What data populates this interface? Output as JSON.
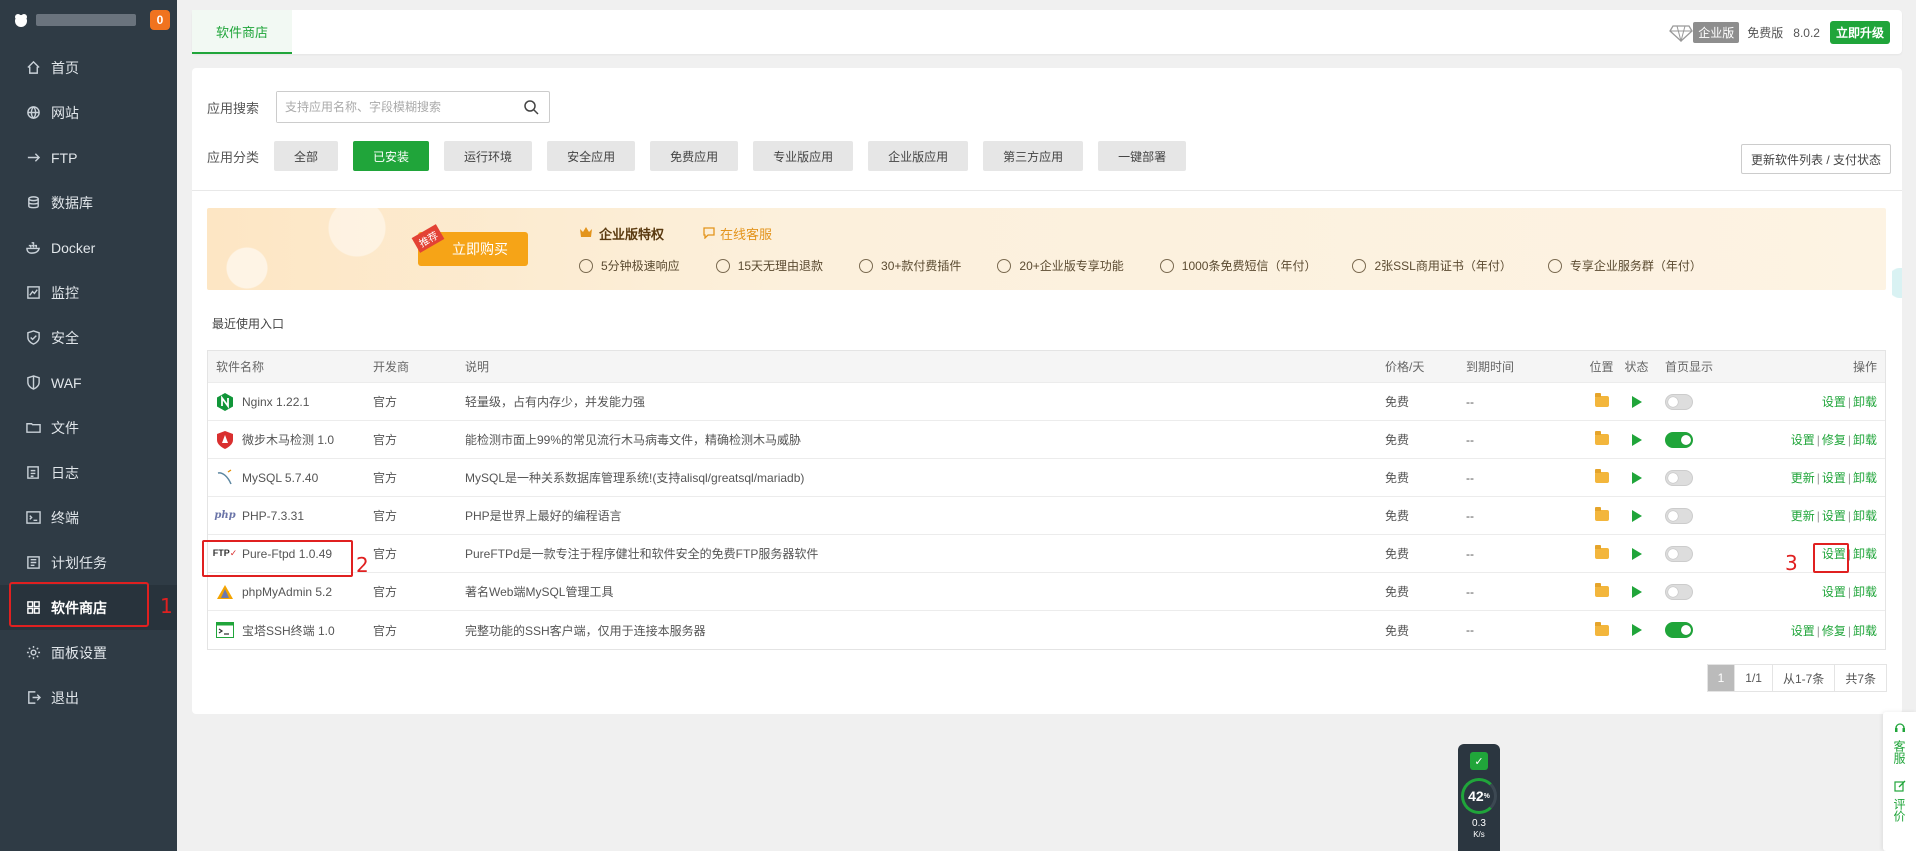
{
  "sidebar": {
    "badge": "0",
    "items": [
      {
        "label": "首页",
        "icon": "home-icon"
      },
      {
        "label": "网站",
        "icon": "globe-icon"
      },
      {
        "label": "FTP",
        "icon": "ftp-icon"
      },
      {
        "label": "数据库",
        "icon": "database-icon"
      },
      {
        "label": "Docker",
        "icon": "docker-icon"
      },
      {
        "label": "监控",
        "icon": "monitor-icon"
      },
      {
        "label": "安全",
        "icon": "shield-icon"
      },
      {
        "label": "WAF",
        "icon": "waf-shield-icon"
      },
      {
        "label": "文件",
        "icon": "folder-icon"
      },
      {
        "label": "日志",
        "icon": "log-icon"
      },
      {
        "label": "终端",
        "icon": "terminal-icon"
      },
      {
        "label": "计划任务",
        "icon": "clock-icon"
      },
      {
        "label": "软件商店",
        "icon": "grid-icon"
      },
      {
        "label": "面板设置",
        "icon": "gear-icon"
      },
      {
        "label": "退出",
        "icon": "logout-icon"
      }
    ],
    "active_index": 12
  },
  "annotations": {
    "one": "1",
    "two": "2",
    "three": "3"
  },
  "topbar": {
    "tab": "软件商店",
    "enterprise_tag": "企业版",
    "free_label": "免费版",
    "version": "8.0.2",
    "upgrade": "立即升级"
  },
  "search": {
    "label": "应用搜索",
    "placeholder": "支持应用名称、字段模糊搜索"
  },
  "categories": {
    "label": "应用分类",
    "items": [
      "全部",
      "已安装",
      "运行环境",
      "安全应用",
      "免费应用",
      "专业版应用",
      "企业版应用",
      "第三方应用",
      "一键部署"
    ],
    "active_index": 1
  },
  "refresh_button": "更新软件列表 / 支付状态",
  "banner": {
    "recommend_tag": "推荐",
    "buy": "立即购买",
    "privilege": "企业版特权",
    "online_service": "在线客服",
    "features": [
      "5分钟极速响应",
      "15天无理由退款",
      "30+款付费插件",
      "20+企业版专享功能",
      "1000条免费短信（年付）",
      "2张SSL商用证书（年付）",
      "专享企业服务群（年付）"
    ]
  },
  "recent_label": "最近使用入口",
  "table": {
    "headers": [
      "软件名称",
      "开发商",
      "说明",
      "价格/天",
      "到期时间",
      "位置",
      "状态",
      "首页显示",
      "操作"
    ],
    "rows": [
      {
        "name": "Nginx 1.22.1",
        "dev": "官方",
        "desc": "轻量级，占有内存少，并发能力强",
        "price": "免费",
        "expire": "--",
        "home_on": false,
        "actions": [
          "设置",
          "卸载"
        ],
        "icon": "nginx-icon"
      },
      {
        "name": "微步木马检测 1.0",
        "dev": "官方",
        "desc": "能检测市面上99%的常见流行木马病毒文件，精确检测木马威胁",
        "price": "免费",
        "expire": "--",
        "home_on": true,
        "actions": [
          "设置",
          "修复",
          "卸载"
        ],
        "icon": "shield-red-icon"
      },
      {
        "name": "MySQL 5.7.40",
        "dev": "官方",
        "desc": "MySQL是一种关系数据库管理系统!(支持alisql/greatsql/mariadb)",
        "price": "免费",
        "expire": "--",
        "home_on": false,
        "actions": [
          "更新",
          "设置",
          "卸载"
        ],
        "icon": "mysql-icon"
      },
      {
        "name": "PHP-7.3.31",
        "dev": "官方",
        "desc": "PHP是世界上最好的编程语言",
        "price": "免费",
        "expire": "--",
        "home_on": false,
        "actions": [
          "更新",
          "设置",
          "卸载"
        ],
        "icon": "php-icon"
      },
      {
        "name": "Pure-Ftpd 1.0.49",
        "dev": "官方",
        "desc": "PureFTPd是一款专注于程序健壮和软件安全的免费FTP服务器软件",
        "price": "免费",
        "expire": "--",
        "home_on": false,
        "actions": [
          "设置",
          "卸载"
        ],
        "icon": "ftp-logo-icon"
      },
      {
        "name": "phpMyAdmin 5.2",
        "dev": "官方",
        "desc": "著名Web端MySQL管理工具",
        "price": "免费",
        "expire": "--",
        "home_on": false,
        "actions": [
          "设置",
          "卸载"
        ],
        "icon": "phpmyadmin-icon"
      },
      {
        "name": "宝塔SSH终端 1.0",
        "dev": "官方",
        "desc": "完整功能的SSH客户端，仅用于连接本服务器",
        "price": "免费",
        "expire": "--",
        "home_on": true,
        "actions": [
          "设置",
          "修复",
          "卸载"
        ],
        "icon": "terminal-app-icon"
      }
    ]
  },
  "pager": {
    "current": "1",
    "pages": "1/1",
    "range": "从1-7条",
    "total": "共7条"
  },
  "float_right": {
    "service": "客服",
    "review": "评价"
  },
  "monitor": {
    "percent": "42",
    "percent_unit": "%",
    "speed": "0.3",
    "speed_unit": "K/s"
  },
  "colors": {
    "accent": "#20a53a",
    "sidebar": "#2f3b45",
    "annotation": "#e02020"
  }
}
